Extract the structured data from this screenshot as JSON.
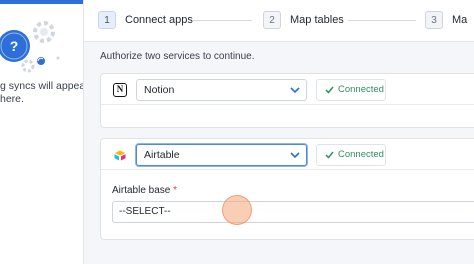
{
  "sidebar": {
    "illustration_icon": "question-sync-gears-icon",
    "empty_line1": "g syncs will appear",
    "empty_line2": "here."
  },
  "stepper": {
    "steps": [
      {
        "number": "1",
        "label": "Connect apps",
        "active": true
      },
      {
        "number": "2",
        "label": "Map tables",
        "active": false
      },
      {
        "number": "3",
        "label": "Ma",
        "active": false
      }
    ]
  },
  "main": {
    "description": "Authorize two services to continue.",
    "services": [
      {
        "icon": "notion-icon",
        "app_value": "Notion",
        "status": "Connected"
      },
      {
        "icon": "airtable-icon",
        "app_value": "Airtable",
        "status": "Connected"
      }
    ],
    "airtable_base": {
      "label": "Airtable base",
      "required_mark": "*",
      "value": "--SELECT--"
    }
  },
  "colors": {
    "accent": "#2d6fd8",
    "connected_green": "#2f8f63",
    "cursor_highlight": "#f5a678"
  }
}
